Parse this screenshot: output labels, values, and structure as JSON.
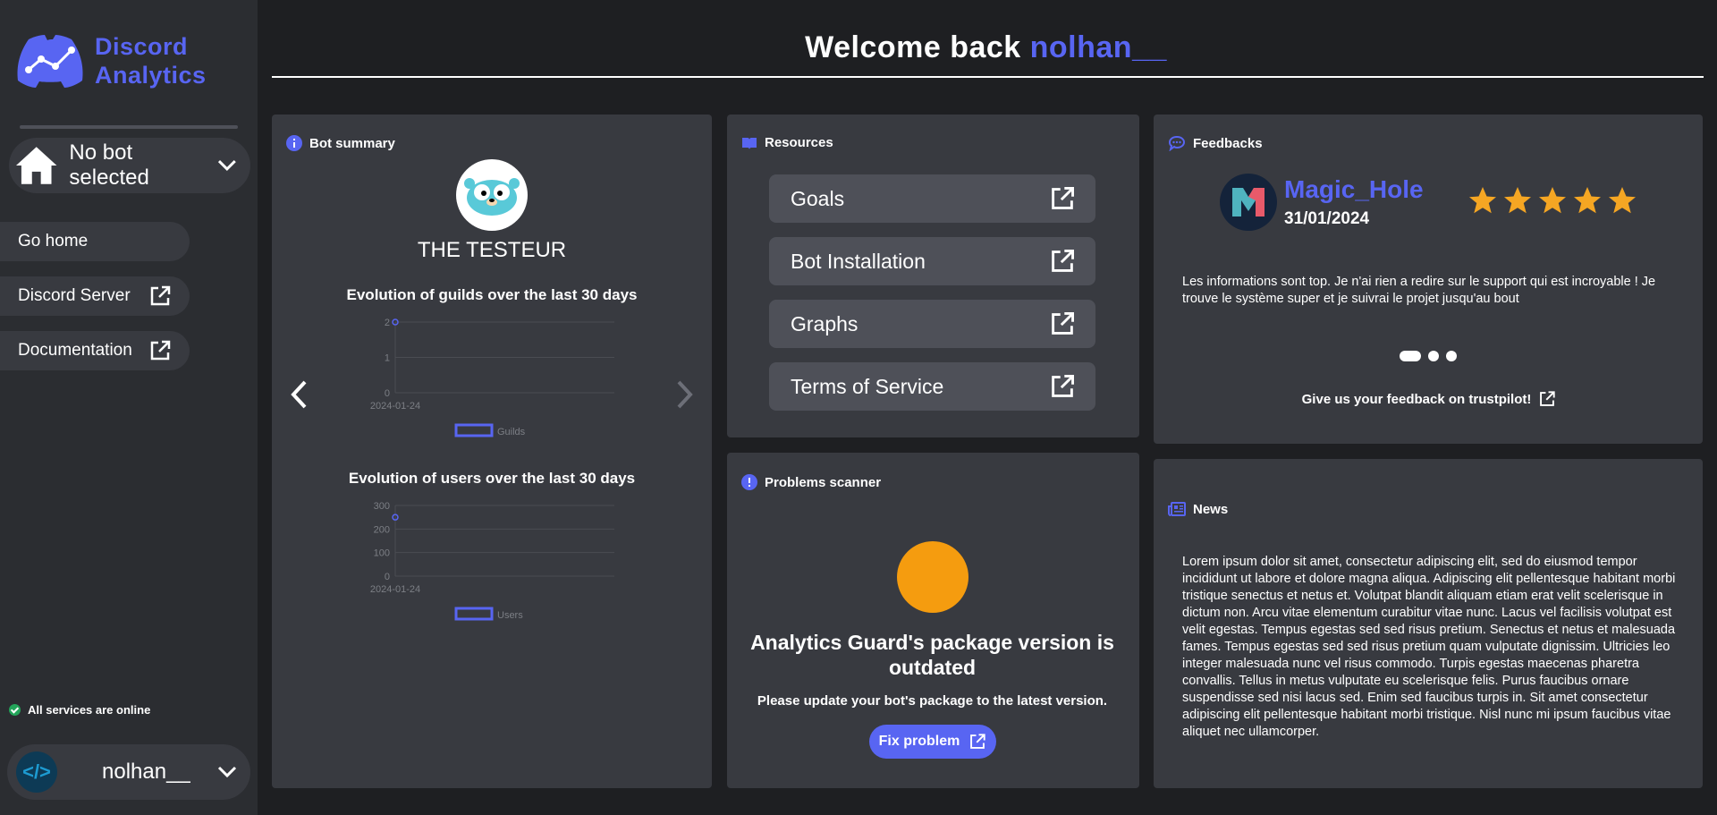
{
  "sidebar": {
    "logo": {
      "line1": "Discord",
      "line2": "Analytics"
    },
    "bot_select": {
      "label": "No bot selected"
    },
    "nav": [
      {
        "label": "Go home"
      },
      {
        "label": "Discord Server"
      },
      {
        "label": "Documentation"
      }
    ],
    "status": "All services are online",
    "user": {
      "name": "nolhan__"
    }
  },
  "header": {
    "welcome": "Welcome back",
    "username": "nolhan__"
  },
  "bot_summary": {
    "title": "Bot summary",
    "bot_name": "THE TESTEUR",
    "charts": [
      {
        "title": "Evolution of guilds over the last 30 days"
      },
      {
        "title": "Evolution of users over the last 30 days"
      }
    ]
  },
  "chart_data": [
    {
      "type": "line",
      "title": "Evolution of guilds over the last 30 days",
      "x": [
        "2024-01-24"
      ],
      "series": [
        {
          "name": "Guilds",
          "values": [
            2
          ]
        }
      ],
      "yticks": [
        "0",
        "1",
        "2"
      ],
      "ylim": [
        0,
        2
      ],
      "legend": "bottom"
    },
    {
      "type": "line",
      "title": "Evolution of users over the last 30 days",
      "x": [
        "2024-01-24"
      ],
      "series": [
        {
          "name": "Users",
          "values": [
            250
          ]
        }
      ],
      "yticks": [
        "0",
        "100",
        "200",
        "300"
      ],
      "ylim": [
        0,
        300
      ],
      "legend": "bottom"
    }
  ],
  "resources": {
    "title": "Resources",
    "items": [
      {
        "label": "Goals"
      },
      {
        "label": "Bot Installation"
      },
      {
        "label": "Graphs"
      },
      {
        "label": "Terms of Service"
      }
    ]
  },
  "feedbacks": {
    "title": "Feedbacks",
    "author": "Magic_Hole",
    "date": "31/01/2024",
    "rating": 5,
    "text": "Les informations sont top. Je n'ai rien a redire sur le support qui est incroyable ! Je trouve le système super et je suivrai le projet jusqu'au bout",
    "cta": "Give us your feedback on trustpilot!"
  },
  "problems": {
    "title": "Problems scanner",
    "headline": "Analytics Guard's package version is outdated",
    "subtitle": "Please update your bot's package to the latest version.",
    "button": "Fix problem"
  },
  "news": {
    "title": "News",
    "text": "Lorem ipsum dolor sit amet, consectetur adipiscing elit, sed do eiusmod tempor incididunt ut labore et dolore magna aliqua. Adipiscing elit pellentesque habitant morbi tristique senectus et netus et. Volutpat blandit aliquam etiam erat velit scelerisque in dictum non. Arcu vitae elementum curabitur vitae nunc. Lacus vel facilisis volutpat est velit egestas. Tempus egestas sed sed risus pretium. Senectus et netus et malesuada fames. Tempus egestas sed sed risus pretium quam vulputate dignissim. Ultricies leo integer malesuada nunc vel risus commodo. Turpis egestas maecenas pharetra convallis. Tellus in metus vulputate eu scelerisque felis. Purus faucibus ornare suspendisse sed nisi lacus sed. Enim sed faucibus turpis in. Sit amet consectetur adipiscing elit pellentesque habitant morbi tristique. Nisl nunc mi ipsum faucibus vitae aliquet nec ullamcorper."
  },
  "colors": {
    "accent": "#5865f2",
    "warning": "#f59c0f",
    "online": "#23a55a",
    "star": "#f5a623"
  }
}
